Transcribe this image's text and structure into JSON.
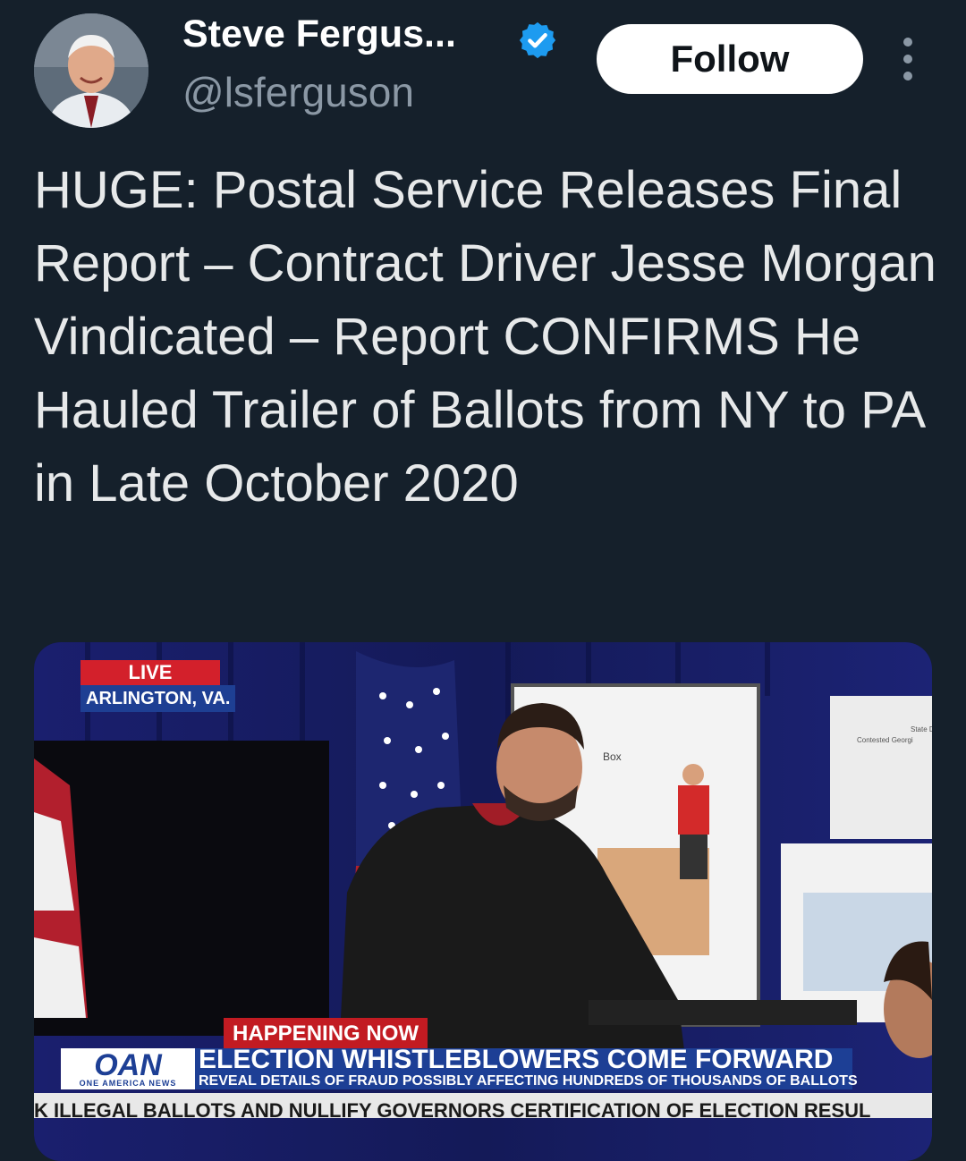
{
  "author": {
    "display_name": "Steve Fergus...",
    "handle": "@lsferguson",
    "verified": true
  },
  "actions": {
    "follow_label": "Follow"
  },
  "tweet": {
    "text": "HUGE: Postal Service Releases Final Report – Contract Driver Jesse Morgan Vindicated – Report CONFIRMS He Hauled Trailer of Ballots from NY to PA in Late October 2020"
  },
  "media": {
    "live_label": "LIVE",
    "location": "ARLINGTON, VA.",
    "happening_now": "HAPPENING NOW",
    "network_logo": "OAN",
    "network_name": "ONE AMERICA NEWS",
    "headline": "ELECTION WHISTLEBLOWERS COME FORWARD",
    "subheadline": "REVEAL DETAILS OF FRAUD POSSIBLY AFFECTING HUNDREDS OF THOUSANDS OF BALLOTS",
    "ticker": "K ILLEGAL BALLOTS AND NULLIFY GOVERNORS CERTIFICATION OF ELECTION RESUL",
    "poster_left_label": "Box",
    "poster_right_label": "State D Contested Georgi"
  },
  "colors": {
    "background": "#15202b",
    "verified_badge": "#1d9bf0",
    "follow_bg": "#ffffff",
    "live_red": "#d3202b",
    "oan_blue": "#1d3f95"
  }
}
